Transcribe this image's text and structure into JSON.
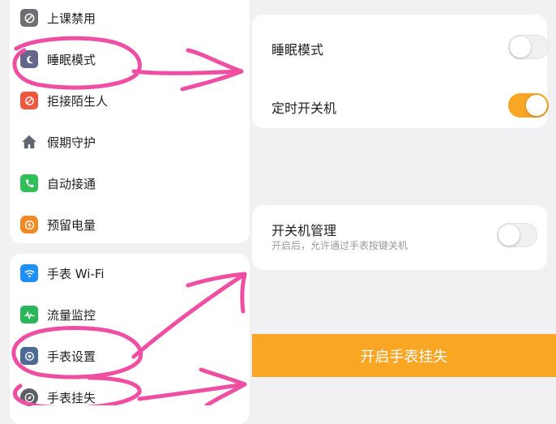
{
  "left_groups": [
    {
      "items": [
        {
          "label": "上课禁用",
          "icon": "ban-icon",
          "color": "#6e6e73"
        },
        {
          "label": "睡眠模式",
          "icon": "moon-icon",
          "color": "#64668a"
        },
        {
          "label": "拒接陌生人",
          "icon": "block-call-icon",
          "color": "#f0573f"
        },
        {
          "label": "假期守护",
          "icon": "house-icon",
          "color": "#5f6670"
        },
        {
          "label": "自动接通",
          "icon": "phone-icon",
          "color": "#2fc05a"
        },
        {
          "label": "预留电量",
          "icon": "battery-bolt-icon",
          "color": "#f08a24"
        }
      ]
    },
    {
      "items": [
        {
          "label": "手表 Wi-Fi",
          "icon": "wifi-icon",
          "color": "#1e8ff5"
        },
        {
          "label": "流量监控",
          "icon": "traffic-icon",
          "color": "#2bb65a"
        },
        {
          "label": "手表设置",
          "icon": "settings-icon",
          "color": "#4c6a96"
        },
        {
          "label": "手表挂失",
          "icon": "compass-icon",
          "color": "#5c5f66"
        }
      ]
    }
  ],
  "right": {
    "sleep_mode": {
      "label": "睡眠模式",
      "enabled": false
    },
    "timed_power": {
      "label": "定时开关机",
      "enabled": true
    },
    "power_management": {
      "label": "开关机管理",
      "subtitle": "开启后，允许通过手表按键关机",
      "enabled": false
    },
    "report_lost_button": "开启手表挂失"
  },
  "colors": {
    "accent": "#f8a623",
    "annotation": "#ee4fa3"
  }
}
